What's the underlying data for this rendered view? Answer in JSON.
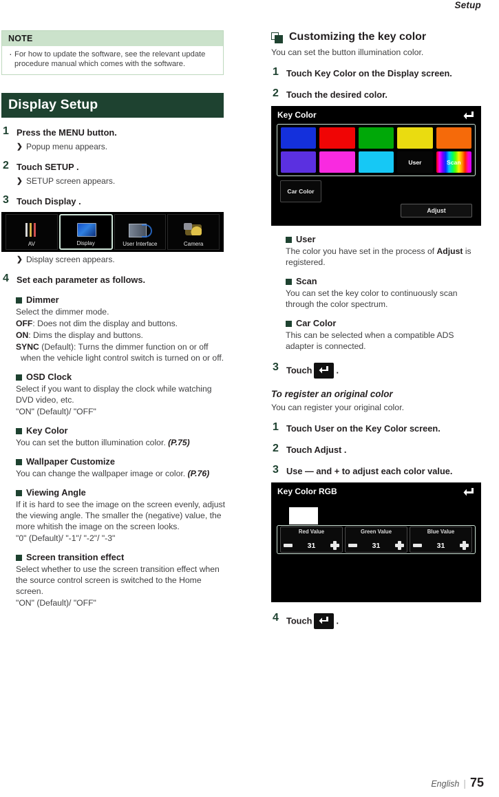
{
  "running_head": {
    "title": "Setup"
  },
  "footer": {
    "language": "English",
    "separator": "|",
    "page_number": "75"
  },
  "left_column": {
    "note": {
      "heading": "NOTE",
      "items": [
        "For how to update the software, see the relevant update procedure manual which comes with the software."
      ]
    },
    "section_title": "Display Setup",
    "steps": [
      {
        "num": "1",
        "text": "Press the MENU button.",
        "result": "Popup menu appears."
      },
      {
        "num": "2",
        "text": "Touch SETUP .",
        "result": "SETUP screen appears."
      },
      {
        "num": "3",
        "text": "Touch Display .",
        "result": "Display screen appears."
      },
      {
        "num": "4",
        "text": "Set each parameter as follows.",
        "result": ""
      }
    ],
    "setup_menu_screen": {
      "items": [
        {
          "label": "AV",
          "icon": "av-cables-icon",
          "selected": false
        },
        {
          "label": "Display",
          "icon": "display-monitor-icon",
          "selected": true
        },
        {
          "label": "User Interface",
          "icon": "user-interface-icon",
          "selected": false
        },
        {
          "label": "Camera",
          "icon": "camera-icon",
          "selected": false
        }
      ]
    },
    "parameters": [
      {
        "name": "Dimmer",
        "desc": "Select the dimmer mode.",
        "options": [
          {
            "key": "OFF",
            "text": ": Does not dim the display and buttons."
          },
          {
            "key": "ON",
            "text": ": Dims the display and buttons."
          },
          {
            "key": "SYNC",
            "text": " (Default): Turns the dimmer function on or off when the vehicle light control switch is turned on or off."
          }
        ]
      },
      {
        "name": "OSD Clock",
        "desc": "Select if you want to display the clock while watching DVD video, etc.",
        "values": "\"ON\" (Default)/ \"OFF\""
      },
      {
        "name": "Key Color",
        "desc": "You can set the button illumination color.",
        "ref": "(P.75)"
      },
      {
        "name": "Wallpaper Customize",
        "desc": "You can change the wallpaper image or color.",
        "ref": "(P.76)"
      },
      {
        "name": "Viewing Angle",
        "desc": "If it is hard to see the image on the screen evenly, adjust the viewing angle. The smaller the (negative) value, the more whitish the image on the screen looks.",
        "values": "\"0\" (Default)/ \"-1\"/ \"-2\"/ \"-3\""
      },
      {
        "name": "Screen transition effect",
        "desc": "Select whether to use the screen transition effect when the source control screen is switched to the Home screen.",
        "values": "\"ON\" (Default)/ \"OFF\""
      }
    ]
  },
  "right_column": {
    "heading": "Customizing the key color",
    "lead": "You can set the button illumination color.",
    "steps": [
      {
        "num": "1",
        "text": "Touch Key Color on the Display screen."
      },
      {
        "num": "2",
        "text": "Touch the desired color."
      }
    ],
    "key_color_screen": {
      "title": "Key Color",
      "back_icon": "back-arrow-icon",
      "swatches_row1": [
        {
          "name": "blue",
          "color": "#1430dc"
        },
        {
          "name": "red",
          "color": "#f00505"
        },
        {
          "name": "green",
          "color": "#00a808"
        },
        {
          "name": "yellow",
          "color": "#eadc10"
        },
        {
          "name": "orange",
          "color": "#f56a0a"
        }
      ],
      "swatches_row2": [
        {
          "name": "purple",
          "color": "#5b30e0"
        },
        {
          "name": "magenta",
          "color": "#f92ae0"
        },
        {
          "name": "cyan",
          "color": "#16c8f5"
        },
        {
          "name": "user",
          "color": "#060606",
          "label": "User"
        },
        {
          "name": "scan",
          "color": "spectrum",
          "label": "Scan"
        }
      ],
      "car_color_button": "Car Color",
      "adjust_button": "Adjust"
    },
    "descriptions": [
      {
        "name": "User",
        "desc_before": "The color you have set in the process of",
        "bold": "Adjust",
        "desc_after": "is registered."
      },
      {
        "name": "Scan",
        "desc": "You can set the key color to continuously scan through the color spectrum."
      },
      {
        "name": "Car Color",
        "desc": "This can be selected when a compatible ADS adapter is connected."
      }
    ],
    "step3": {
      "num": "3",
      "label": "Touch",
      "icon": "back-arrow-icon",
      "period": "."
    },
    "register_section": {
      "heading": "To register an original color",
      "lead": "You can register your original color.",
      "steps": [
        {
          "num": "1",
          "text": "Touch User on the Key Color screen."
        },
        {
          "num": "2",
          "text": "Touch Adjust ."
        },
        {
          "num": "3",
          "text": "Use — and + to adjust each color value."
        }
      ]
    },
    "rgb_screen": {
      "title": "Key Color RGB",
      "back_icon": "back-arrow-icon",
      "preview_color": "#ffffff",
      "sliders": [
        {
          "label": "Red Value",
          "value": "31",
          "minus": "–",
          "plus": "+"
        },
        {
          "label": "Green Value",
          "value": "31",
          "minus": "–",
          "plus": "+"
        },
        {
          "label": "Blue Value",
          "value": "31",
          "minus": "–",
          "plus": "+"
        }
      ]
    },
    "step4": {
      "num": "4",
      "label": "Touch",
      "icon": "back-arrow-icon",
      "period": "."
    }
  },
  "theme": {
    "dark_green": "#1e4230",
    "light_green": "#cbe2cb",
    "body_gray": "#3f3f40"
  }
}
